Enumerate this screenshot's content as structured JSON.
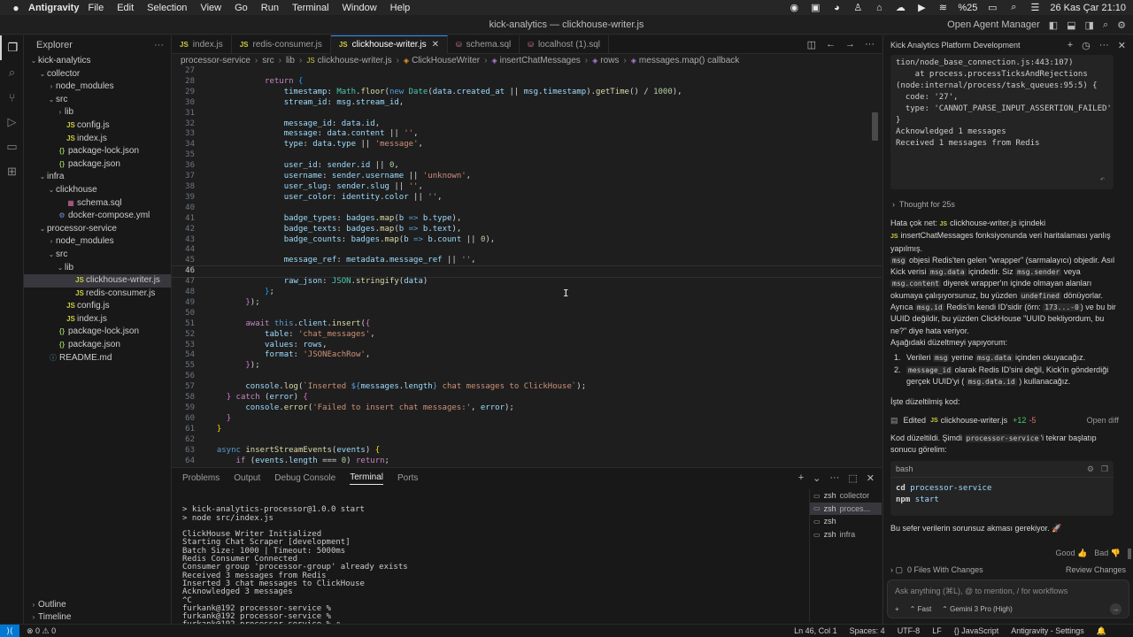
{
  "menubar": {
    "app_name": "Antigravity",
    "items": [
      "File",
      "Edit",
      "Selection",
      "View",
      "Go",
      "Run",
      "Terminal",
      "Window",
      "Help"
    ],
    "battery": "%25",
    "datetime": "26 Kas Çar  21:10"
  },
  "window": {
    "title": "kick-analytics — clickhouse-writer.js",
    "open_agent_manager": "Open Agent Manager"
  },
  "explorer": {
    "title": "Explorer",
    "tree": [
      {
        "label": "kick-analytics",
        "type": "folder",
        "depth": 0,
        "open": true
      },
      {
        "label": "collector",
        "type": "folder",
        "depth": 1,
        "open": true
      },
      {
        "label": "node_modules",
        "type": "folder",
        "depth": 2,
        "open": false
      },
      {
        "label": "src",
        "type": "folder",
        "depth": 2,
        "open": true
      },
      {
        "label": "lib",
        "type": "folder",
        "depth": 3,
        "open": false
      },
      {
        "label": "config.js",
        "type": "js",
        "depth": 3
      },
      {
        "label": "index.js",
        "type": "js",
        "depth": 3
      },
      {
        "label": "package-lock.json",
        "type": "json",
        "depth": 2
      },
      {
        "label": "package.json",
        "type": "json",
        "depth": 2
      },
      {
        "label": "infra",
        "type": "folder",
        "depth": 1,
        "open": true
      },
      {
        "label": "clickhouse",
        "type": "folder",
        "depth": 2,
        "open": true
      },
      {
        "label": "schema.sql",
        "type": "sql",
        "depth": 3
      },
      {
        "label": "docker-compose.yml",
        "type": "yml",
        "depth": 2
      },
      {
        "label": "processor-service",
        "type": "folder",
        "depth": 1,
        "open": true
      },
      {
        "label": "node_modules",
        "type": "folder",
        "depth": 2,
        "open": false
      },
      {
        "label": "src",
        "type": "folder",
        "depth": 2,
        "open": true
      },
      {
        "label": "lib",
        "type": "folder",
        "depth": 3,
        "open": true
      },
      {
        "label": "clickhouse-writer.js",
        "type": "js",
        "depth": 4,
        "selected": true
      },
      {
        "label": "redis-consumer.js",
        "type": "js",
        "depth": 4
      },
      {
        "label": "config.js",
        "type": "js",
        "depth": 3
      },
      {
        "label": "index.js",
        "type": "js",
        "depth": 3
      },
      {
        "label": "package-lock.json",
        "type": "json",
        "depth": 2
      },
      {
        "label": "package.json",
        "type": "json",
        "depth": 2
      },
      {
        "label": "README.md",
        "type": "md",
        "depth": 1
      }
    ],
    "outline_label": "Outline",
    "timeline_label": "Timeline"
  },
  "tabs": [
    {
      "label": "index.js",
      "icon": "JS",
      "type": "js"
    },
    {
      "label": "redis-consumer.js",
      "icon": "JS",
      "type": "js"
    },
    {
      "label": "clickhouse-writer.js",
      "icon": "JS",
      "type": "js",
      "active": true
    },
    {
      "label": "schema.sql",
      "icon": "db",
      "type": "sql"
    },
    {
      "label": "localhost (1).sql",
      "icon": "db",
      "type": "sql"
    }
  ],
  "breadcrumb": [
    "processor-service",
    "src",
    "lib",
    "clickhouse-writer.js",
    "ClickHouseWriter",
    "insertChatMessages",
    "rows",
    "messages.map() callback"
  ],
  "editor": {
    "current_line": 46,
    "lines": [
      {
        "n": 27,
        "html": ""
      },
      {
        "n": 28,
        "html": "            <span class='k'>return</span> <span class='p3'>{</span>"
      },
      {
        "n": 29,
        "html": "                <span class='v'>timestamp</span>: <span class='c'>Math</span>.<span class='f'>floor</span>(<span class='kb'>new</span> <span class='c'>Date</span>(<span class='v'>data</span>.<span class='v'>created_at</span> || <span class='v'>msg</span>.<span class='v'>timestamp</span>).<span class='f'>getTime</span>() / <span class='n'>1000</span>),"
      },
      {
        "n": 30,
        "html": "                <span class='v'>stream_id</span>: <span class='v'>msg</span>.<span class='v'>stream_id</span>,"
      },
      {
        "n": 31,
        "html": ""
      },
      {
        "n": 32,
        "html": "                <span class='v'>message_id</span>: <span class='v'>data</span>.<span class='v'>id</span>,"
      },
      {
        "n": 33,
        "html": "                <span class='v'>message</span>: <span class='v'>data</span>.<span class='v'>content</span> || <span class='s'>''</span>,"
      },
      {
        "n": 34,
        "html": "                <span class='v'>type</span>: <span class='v'>data</span>.<span class='v'>type</span> || <span class='s'>'message'</span>,"
      },
      {
        "n": 35,
        "html": ""
      },
      {
        "n": 36,
        "html": "                <span class='v'>user_id</span>: <span class='v'>sender</span>.<span class='v'>id</span> || <span class='n'>0</span>,"
      },
      {
        "n": 37,
        "html": "                <span class='v'>username</span>: <span class='v'>sender</span>.<span class='v'>username</span> || <span class='s'>'unknown'</span>,"
      },
      {
        "n": 38,
        "html": "                <span class='v'>user_slug</span>: <span class='v'>sender</span>.<span class='v'>slug</span> || <span class='s'>''</span>,"
      },
      {
        "n": 39,
        "html": "                <span class='v'>user_color</span>: <span class='v'>identity</span>.<span class='v'>color</span> || <span class='s'>''</span>,"
      },
      {
        "n": 40,
        "html": ""
      },
      {
        "n": 41,
        "html": "                <span class='v'>badge_types</span>: <span class='v'>badges</span>.<span class='f'>map</span>(<span class='v'>b</span> <span class='kb'>=&gt;</span> <span class='v'>b</span>.<span class='v'>type</span>),"
      },
      {
        "n": 42,
        "html": "                <span class='v'>badge_texts</span>: <span class='v'>badges</span>.<span class='f'>map</span>(<span class='v'>b</span> <span class='kb'>=&gt;</span> <span class='v'>b</span>.<span class='v'>text</span>),"
      },
      {
        "n": 43,
        "html": "                <span class='v'>badge_counts</span>: <span class='v'>badges</span>.<span class='f'>map</span>(<span class='v'>b</span> <span class='kb'>=&gt;</span> <span class='v'>b</span>.<span class='v'>count</span> || <span class='n'>0</span>),"
      },
      {
        "n": 44,
        "html": ""
      },
      {
        "n": 45,
        "html": "                <span class='v'>message_ref</span>: <span class='v'>metadata</span>.<span class='v'>message_ref</span> || <span class='s'>''</span>,"
      },
      {
        "n": 46,
        "html": ""
      },
      {
        "n": 47,
        "html": "                <span class='v'>raw_json</span>: <span class='c'>JSON</span>.<span class='f'>stringify</span>(<span class='v'>data</span>)"
      },
      {
        "n": 48,
        "html": "            <span class='p3'>}</span>;"
      },
      {
        "n": 49,
        "html": "        <span class='p2'>}</span>);"
      },
      {
        "n": 50,
        "html": ""
      },
      {
        "n": 51,
        "html": "        <span class='k'>await</span> <span class='kb'>this</span>.<span class='v'>client</span>.<span class='f'>insert</span>(<span class='p2'>{</span>"
      },
      {
        "n": 52,
        "html": "            <span class='v'>table</span>: <span class='s'>'chat_messages'</span>,"
      },
      {
        "n": 53,
        "html": "            <span class='v'>values</span>: <span class='v'>rows</span>,"
      },
      {
        "n": 54,
        "html": "            <span class='v'>format</span>: <span class='s'>'JSONEachRow'</span>,"
      },
      {
        "n": 55,
        "html": "        <span class='p2'>}</span>);"
      },
      {
        "n": 56,
        "html": ""
      },
      {
        "n": 57,
        "html": "        <span class='v'>console</span>.<span class='f'>log</span>(<span class='s'>`Inserted </span><span class='kb'>${</span><span class='v'>messages</span>.<span class='v'>length</span><span class='kb'>}</span><span class='s'> chat messages to ClickHouse`</span>);"
      },
      {
        "n": 58,
        "html": "    <span class='p2'>}</span> <span class='k'>catch</span> (<span class='v'>error</span>) <span class='p2'>{</span>"
      },
      {
        "n": 59,
        "html": "        <span class='v'>console</span>.<span class='f'>error</span>(<span class='s'>'Failed to insert chat messages:'</span>, <span class='v'>error</span>);"
      },
      {
        "n": 60,
        "html": "    <span class='p2'>}</span>"
      },
      {
        "n": 61,
        "html": "  <span class='p'>}</span>"
      },
      {
        "n": 62,
        "html": ""
      },
      {
        "n": 63,
        "html": "  <span class='kb'>async</span> <span class='f'>insertStreamEvents</span>(<span class='v'>events</span>) <span class='p'>{</span>"
      },
      {
        "n": 64,
        "html": "      <span class='k'>if</span> (<span class='v'>events</span>.<span class='v'>length</span> === <span class='n'>0</span>) <span class='k'>return</span>;"
      }
    ]
  },
  "panel": {
    "tabs": [
      "Problems",
      "Output",
      "Debug Console",
      "Terminal",
      "Ports"
    ],
    "active_tab": "Terminal",
    "terminal_lines": [
      "",
      "> kick-analytics-processor@1.0.0 start",
      "> node src/index.js",
      "",
      "ClickHouse Writer Initialized",
      "Starting Chat Scraper [development]",
      "Batch Size: 1000 | Timeout: 5000ms",
      "Redis Consumer Connected",
      "Consumer group 'processor-group' already exists",
      "Received 3 messages from Redis",
      "Inserted 3 chat messages to ClickHouse",
      "Acknowledged 3 messages",
      "^C",
      "furkank@192 processor-service %",
      "furkank@192 processor-service %",
      "furkank@192 processor-service % ▯"
    ],
    "terminals": [
      {
        "name": "zsh",
        "dir": "collector"
      },
      {
        "name": "zsh",
        "dir": "proces...",
        "active": true
      },
      {
        "name": "zsh",
        "dir": ""
      },
      {
        "name": "zsh",
        "dir": "infra"
      }
    ]
  },
  "agent": {
    "title": "Kick Analytics Platform Development",
    "log_lines": [
      "tion/node_base_connection.js:443:107)",
      "    at process.processTicksAndRejections",
      "(node:internal/process/task_queues:95:5) {",
      "  code: '27',",
      "  type: 'CANNOT_PARSE_INPUT_ASSERTION_FAILED'",
      "}",
      "Acknowledged 1 messages",
      "Received 1 messages from Redis"
    ],
    "thought": "Thought for 25s",
    "response_html": "Hata çok net: <span class='jsb'>JS</span>clickhouse-writer.js  içindeki <span class='jsb'>JS</span>insertChatMessages  fonksiyonunda veri haritalaması yanlış yapılmış.<br><span class='ic'>msg</span> objesi Redis'ten gelen \"wrapper\" (sarmalayıcı) objedir. Asıl Kick verisi <span class='ic'>msg.data</span> içindedir. Siz <span class='ic'>msg.sender</span> veya <span class='ic'>msg.content</span> diyerek wrapper'ın içinde olmayan alanları okumaya çalışıyorsunuz, bu yüzden <span class='ic'>undefined</span> dönüyorlar. Ayrıca <span class='ic'>msg.id</span> Redis'in kendi ID'sidir (örn: <span class='ic'>173...-0</span>) ve bu bir UUID değildir, bu yüzden ClickHouse \"UUID bekliyordum, bu ne?\" diye hata veriyor.<br>Aşağıdaki düzeltmeyi yapıyorum:",
    "list_items_html": [
      "Verileri <span class='ic'>msg</span> yerine <span class='ic'>msg.data</span> içinden okuyacağız.",
      "<span class='ic'>message_id</span> olarak Redis ID'sini değil, Kick'in gönderdiği gerçek UUID'yi ( <span class='ic'>msg.data.id</span> ) kullanacağız."
    ],
    "fixed_code_label": "İşte düzeltilmiş kod:",
    "edited_label": "Edited",
    "edited_file": "clickhouse-writer.js",
    "edited_plus": "+12",
    "edited_minus": "-5",
    "open_diff": "Open diff",
    "restart_html": "Kod düzeltildi. Şimdi <span class='ic'>processor-service</span>'i tekrar başlatıp sonucu görelim:",
    "bash_label": "bash",
    "bash_lines": [
      {
        "cmd": "cd",
        "arg": "processor-service"
      },
      {
        "cmd": "npm",
        "arg": "start"
      }
    ],
    "closing": "Bu sefer verilerin sorunsuz akması gerekiyor. 🚀",
    "good": "Good",
    "bad": "Bad",
    "files_with_changes": "0 Files With Changes",
    "review_changes": "Review Changes",
    "input_placeholder": "Ask anything (⌘L), @ to mention, / for workflows",
    "mode": "Fast",
    "model": "Gemini 3 Pro (High)"
  },
  "statusbar": {
    "problems": "⊗ 0  ⚠ 0",
    "position": "Ln 46, Col 1",
    "spaces": "Spaces: 4",
    "encoding": "UTF-8",
    "eol": "LF",
    "language": "{} JavaScript",
    "settings": "Antigravity - Settings"
  }
}
